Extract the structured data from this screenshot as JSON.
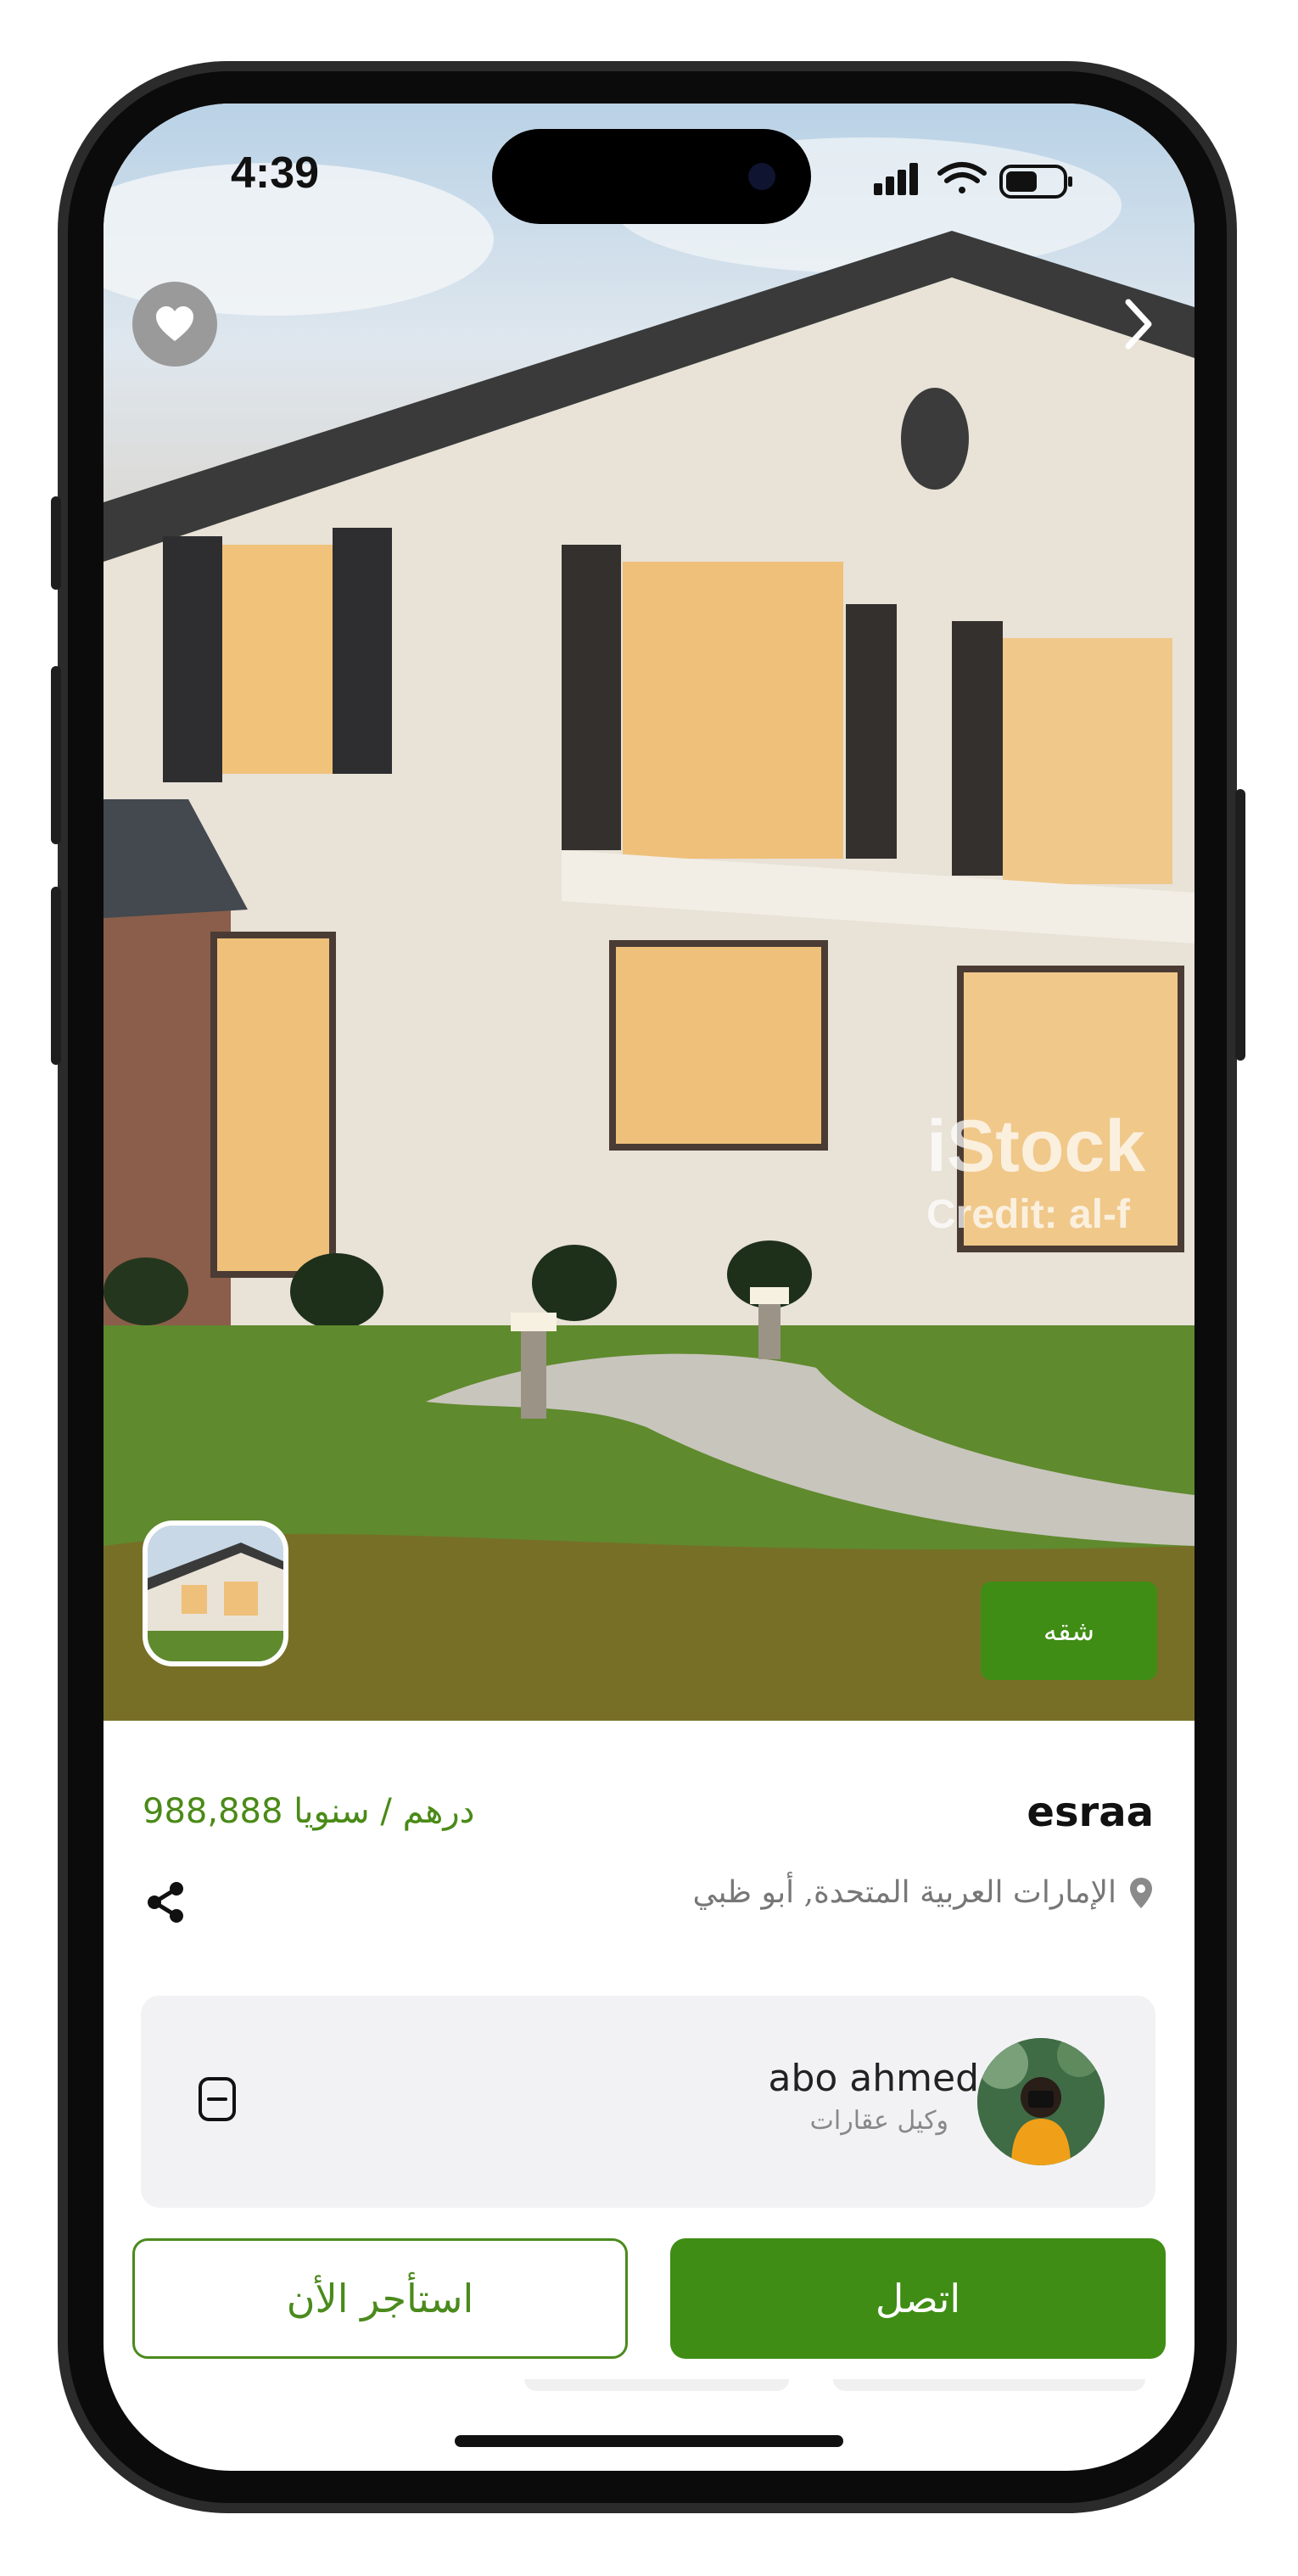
{
  "status_bar": {
    "time": "4:39"
  },
  "listing": {
    "title": "esraa",
    "price": "988,888 درهم / سنويا",
    "location": "الإمارات العربية المتحدة, أبو ظبي",
    "type_badge": "شقه",
    "image_watermark": {
      "brand": "iStock",
      "credit": "Credit: al-f"
    }
  },
  "agent": {
    "name": "abo ahmed",
    "role": "وكيل عقارات"
  },
  "actions": {
    "call_label": "اتصل",
    "rent_label": "استأجر الأن"
  },
  "colors": {
    "accent": "#3f8d14",
    "price_text": "#4a8a17",
    "card_background": "#f2f2f4"
  },
  "icons": [
    "heart-icon",
    "chevron-right-icon",
    "location-pin-icon",
    "share-icon",
    "menu-minus-icon",
    "signal-icon",
    "wifi-icon",
    "battery-icon"
  ]
}
